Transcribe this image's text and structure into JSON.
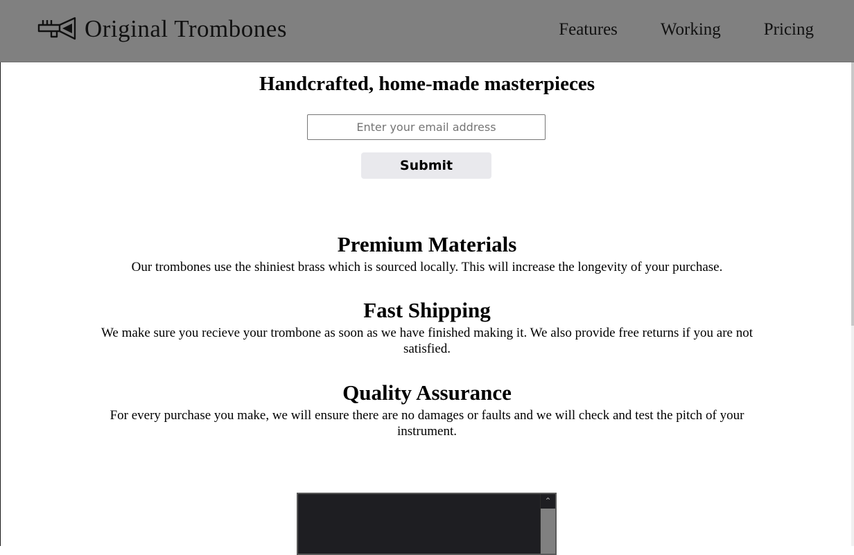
{
  "header": {
    "brand": "Original Trombones",
    "logo_icon": "trombone-logo-icon",
    "nav": [
      {
        "label": "Features"
      },
      {
        "label": "Working"
      },
      {
        "label": "Pricing"
      }
    ],
    "background": "#808080"
  },
  "hero": {
    "title": "Handcrafted, home-made masterpieces",
    "email_placeholder": "Enter your email address",
    "email_value": "",
    "submit_label": "Submit"
  },
  "features": [
    {
      "title": "Premium Materials",
      "text": "Our trombones use the shiniest brass which is sourced locally. This will increase the longevity of your purchase."
    },
    {
      "title": "Fast Shipping",
      "text": "We make sure you recieve your trombone as soon as we have finished making it. We also provide free returns if you are not satisfied."
    },
    {
      "title": "Quality Assurance",
      "text": "For every purchase you make, we will ensure there are no damages or faults and we will check and test the pitch of your instrument."
    }
  ],
  "video": {
    "scroll_up_icon": "chevron-up-icon"
  }
}
